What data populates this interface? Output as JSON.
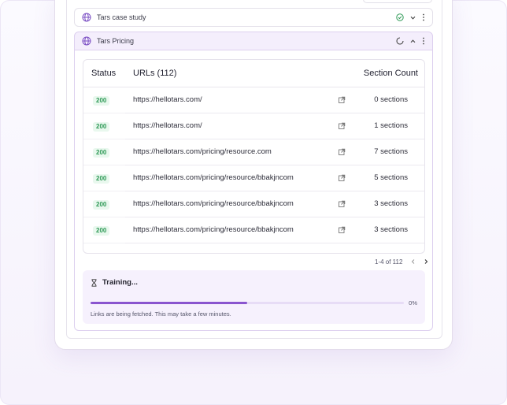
{
  "items": [
    {
      "title": "Tars case study",
      "status_icon": "check-circle-icon",
      "toggle_icon": "chevron-down-icon"
    },
    {
      "title": "Tars Pricing",
      "status_icon": "loading-spinner-icon",
      "toggle_icon": "chevron-up-icon"
    }
  ],
  "table": {
    "headers": {
      "status": "Status",
      "urls": "URLs (112)",
      "count": "Section Count"
    },
    "rows": [
      {
        "status": "200",
        "url": "https://hellotars.com/",
        "count": "0 sections"
      },
      {
        "status": "200",
        "url": "https://hellotars.com/",
        "count": "1 sections"
      },
      {
        "status": "200",
        "url": "https://hellotars.com/pricing/resource.com",
        "count": "7 sections"
      },
      {
        "status": "200",
        "url": "https://hellotars.com/pricing/resource/bbakjncom",
        "count": "5 sections"
      },
      {
        "status": "200",
        "url": "https://hellotars.com/pricing/resource/bbakjncom",
        "count": "3 sections"
      },
      {
        "status": "200",
        "url": "https://hellotars.com/pricing/resource/bbakjncom",
        "count": "3 sections"
      }
    ]
  },
  "pagination": {
    "label": "1-4 of 112"
  },
  "training": {
    "title": "Training...",
    "percent_label": "0%",
    "progress_fraction": 0.5,
    "note": "Links are being fetched. This may take a few minutes."
  },
  "colors": {
    "accent": "#8a55cf",
    "success": "#2f9a57",
    "active_bg": "#f4eefc"
  }
}
